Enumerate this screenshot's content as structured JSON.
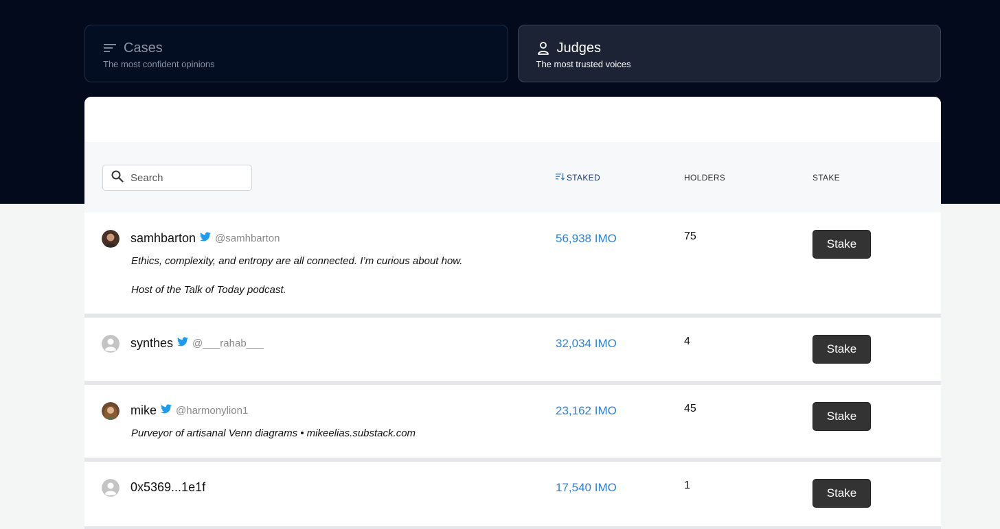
{
  "tabs": [
    {
      "title": "Cases",
      "subtitle": "The most confident opinions",
      "icon": "list-icon",
      "active": false
    },
    {
      "title": "Judges",
      "subtitle": "The most trusted voices",
      "icon": "user-icon",
      "active": true
    }
  ],
  "search": {
    "placeholder": "Search"
  },
  "columns": {
    "staked": "STAKED",
    "holders": "HOLDERS",
    "stake": "STAKE"
  },
  "rows": [
    {
      "name": "samhbarton",
      "handle": "@samhbarton",
      "bio_line1": "Ethics, complexity, and entropy are all connected. I’m curious about how.",
      "bio_line2": "Host of the Talk of Today podcast.",
      "staked": "56,938 IMO",
      "holders": "75",
      "button": "Stake"
    },
    {
      "name": "synthes",
      "handle": "@___rahab___",
      "staked": "32,034 IMO",
      "holders": "4",
      "button": "Stake"
    },
    {
      "name": "mike",
      "handle": "@harmonylion1",
      "bio_line1": "Purveyor of artisanal Venn diagrams • mikeelias.substack.com",
      "staked": "23,162 IMO",
      "holders": "45",
      "button": "Stake"
    },
    {
      "name": "0x5369...1e1f",
      "staked": "17,540 IMO",
      "holders": "1",
      "button": "Stake"
    }
  ],
  "colors": {
    "hero": "#020a1c",
    "link": "#2f80d8",
    "button": "#333333",
    "twitter": "#1d9bf0"
  }
}
